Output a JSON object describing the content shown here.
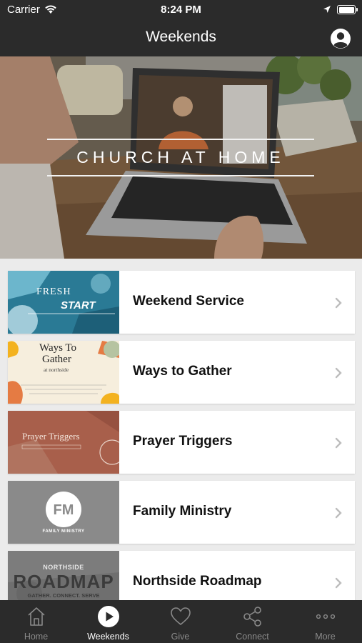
{
  "status_bar": {
    "carrier": "Carrier",
    "time": "8:24 PM"
  },
  "nav": {
    "title": "Weekends"
  },
  "hero": {
    "text": "CHURCH AT HOME"
  },
  "list": {
    "items": [
      {
        "label": "Weekend Service",
        "thumb_text": [
          "FRESH",
          "START"
        ]
      },
      {
        "label": "Ways to Gather",
        "thumb_text": [
          "Ways To",
          "Gather",
          "at northside"
        ]
      },
      {
        "label": "Prayer Triggers",
        "thumb_text": [
          "Prayer Triggers"
        ]
      },
      {
        "label": "Family Ministry",
        "thumb_text": [
          "FM",
          "FAMILY MINISTRY"
        ]
      },
      {
        "label": "Northside Roadmap",
        "thumb_text": [
          "NORTHSIDE",
          "ROADMAP",
          "GATHER. CONNECT. SERVE"
        ]
      }
    ]
  },
  "tabs": [
    {
      "label": "Home",
      "icon": "home-icon"
    },
    {
      "label": "Weekends",
      "icon": "play-circle-icon",
      "active": true
    },
    {
      "label": "Give",
      "icon": "heart-icon"
    },
    {
      "label": "Connect",
      "icon": "share-icon"
    },
    {
      "label": "More",
      "icon": "more-icon"
    }
  ],
  "colors": {
    "bar_bg": "#2b2b2b",
    "list_bg": "#ebebeb",
    "inactive_tab": "#8a8a8a"
  }
}
